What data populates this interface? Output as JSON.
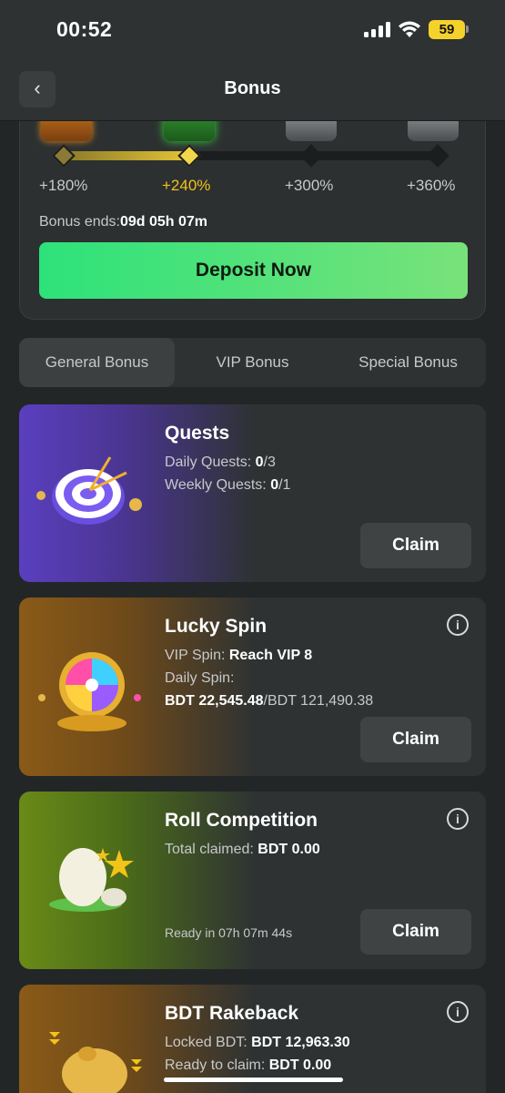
{
  "status": {
    "time": "00:52",
    "battery": "59"
  },
  "header": {
    "title": "Bonus"
  },
  "progress": {
    "levels": [
      "+180%",
      "+240%",
      "+300%",
      "+360%"
    ],
    "active_index": 1,
    "bonus_ends_label": "Bonus ends:",
    "bonus_ends_value": "09d 05h 07m",
    "deposit_label": "Deposit Now"
  },
  "tabs": [
    "General Bonus",
    "VIP Bonus",
    "Special Bonus"
  ],
  "cards": [
    {
      "title": "Quests",
      "lines": [
        {
          "label": "Daily Quests: ",
          "value": "0",
          "suffix": "/3"
        },
        {
          "label": "Weekly Quests: ",
          "value": "0",
          "suffix": "/1"
        }
      ],
      "claim": "Claim"
    },
    {
      "title": "Lucky Spin",
      "lines": [
        {
          "label": "VIP Spin: ",
          "value": "Reach VIP 8"
        },
        {
          "label": "Daily Spin:"
        },
        {
          "value": "BDT 22,545.48",
          "suffix": "/BDT 121,490.38"
        }
      ],
      "claim": "Claim"
    },
    {
      "title": "Roll Competition",
      "lines": [
        {
          "label": "Total claimed: ",
          "value": "BDT 0.00"
        }
      ],
      "ready": "Ready in 07h 07m 44s",
      "claim": "Claim"
    },
    {
      "title": "BDT Rakeback",
      "lines": [
        {
          "label": "Locked BDT: ",
          "value": "BDT 12,963.30"
        },
        {
          "label": "Ready to claim: ",
          "value": "BDT 0.00"
        }
      ]
    }
  ],
  "colors": {
    "accent_gold": "#f2c318",
    "accent_green": "#2de27a"
  }
}
